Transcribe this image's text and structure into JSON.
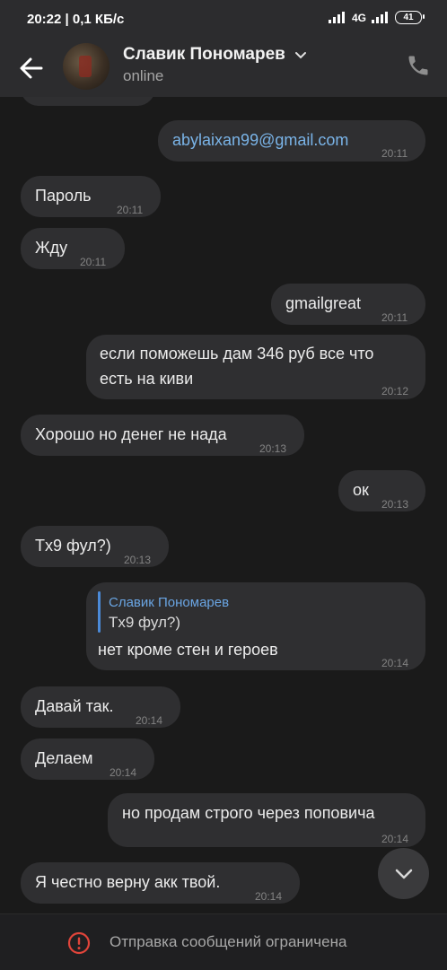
{
  "status_bar": {
    "time_and_speed": "20:22 | 0,1 КБ/с",
    "network": "4G",
    "battery": "41"
  },
  "header": {
    "contact_name": "Славик Пономарев",
    "status": "online"
  },
  "messages": [
    {
      "side": "out",
      "text": "abylaixan99@gmail.com",
      "time": "20:11",
      "is_link": true
    },
    {
      "side": "in",
      "text": "Пароль",
      "time": "20:11"
    },
    {
      "side": "in",
      "text": "Жду",
      "time": "20:11"
    },
    {
      "side": "out",
      "text": "gmailgreat",
      "time": "20:11"
    },
    {
      "side": "out",
      "lines": [
        "если поможешь дам 346 руб все что",
        "есть на киви"
      ],
      "time": "20:12"
    },
    {
      "side": "in",
      "text": "Хорошо но денег не нада",
      "time": "20:13"
    },
    {
      "side": "out",
      "text": "ок",
      "time": "20:13"
    },
    {
      "side": "in",
      "text": "Tx9 фул?)",
      "time": "20:13"
    },
    {
      "side": "out",
      "reply_author": "Славик Пономарев",
      "reply_text": "Tx9 фул?)",
      "text": "нет кроме стен и героев",
      "time": "20:14"
    },
    {
      "side": "in",
      "text": "Давай так.",
      "time": "20:14"
    },
    {
      "side": "in",
      "text": "Делаем",
      "time": "20:14"
    },
    {
      "side": "out",
      "text": "но продам строго через поповича",
      "time": "20:14"
    },
    {
      "side": "in",
      "text": "Я честно верну акк твой.",
      "time": "20:14"
    }
  ],
  "footer": {
    "restriction_text": "Отправка сообщений ограничена"
  },
  "colors": {
    "background": "#1a1a1a",
    "bubble": "#2f2f31",
    "link": "#7ab4e8",
    "warning": "#e0443a"
  },
  "icons": [
    "back-arrow-icon",
    "chevron-down-icon",
    "phone-icon",
    "scroll-down-icon",
    "warning-icon"
  ]
}
